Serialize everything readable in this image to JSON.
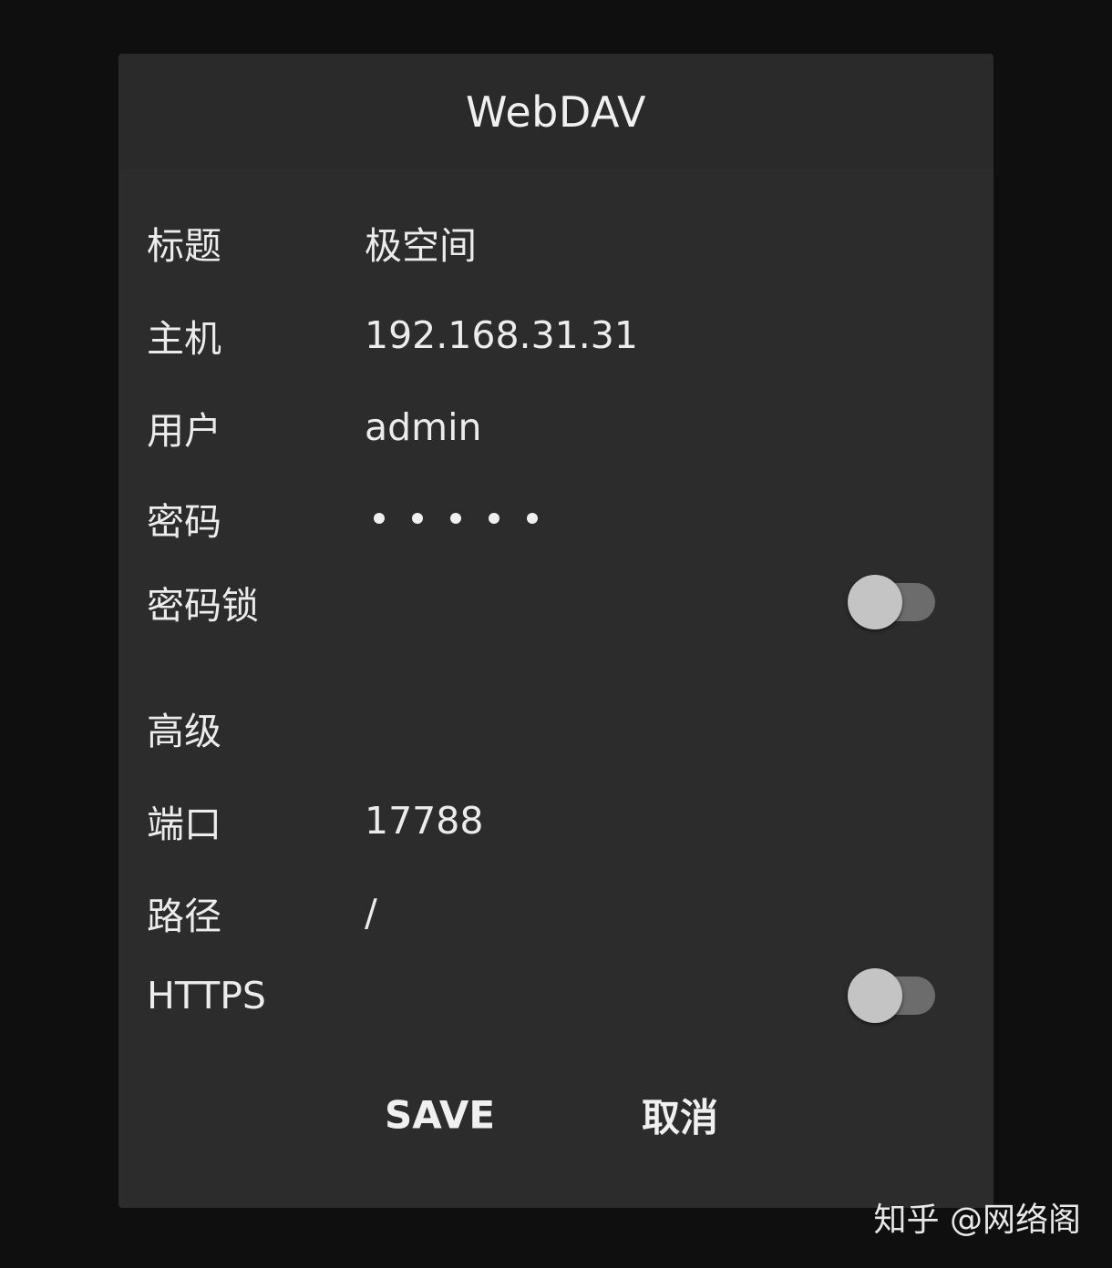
{
  "dialog": {
    "title": "WebDAV",
    "fields": {
      "title": {
        "label": "标题",
        "value": "极空间"
      },
      "host": {
        "label": "主机",
        "value": "192.168.31.31"
      },
      "user": {
        "label": "用户",
        "value": "admin"
      },
      "password": {
        "label": "密码",
        "masked_length": 5
      },
      "password_lock": {
        "label": "密码锁",
        "enabled": false
      }
    },
    "advanced": {
      "section_label": "高级",
      "port": {
        "label": "端口",
        "value": "17788"
      },
      "path": {
        "label": "路径",
        "value": "/"
      },
      "https": {
        "label": "HTTPS",
        "enabled": false
      }
    },
    "actions": {
      "save_label": "SAVE",
      "cancel_label": "取消"
    }
  },
  "watermark": "知乎 @网络阁",
  "colors": {
    "page_background": "#0f0f0f",
    "dialog_background": "#2c2c2c",
    "text": "#ececec",
    "toggle_track_off": "#6c6c6c",
    "toggle_thumb_off": "#c4c4c4"
  }
}
